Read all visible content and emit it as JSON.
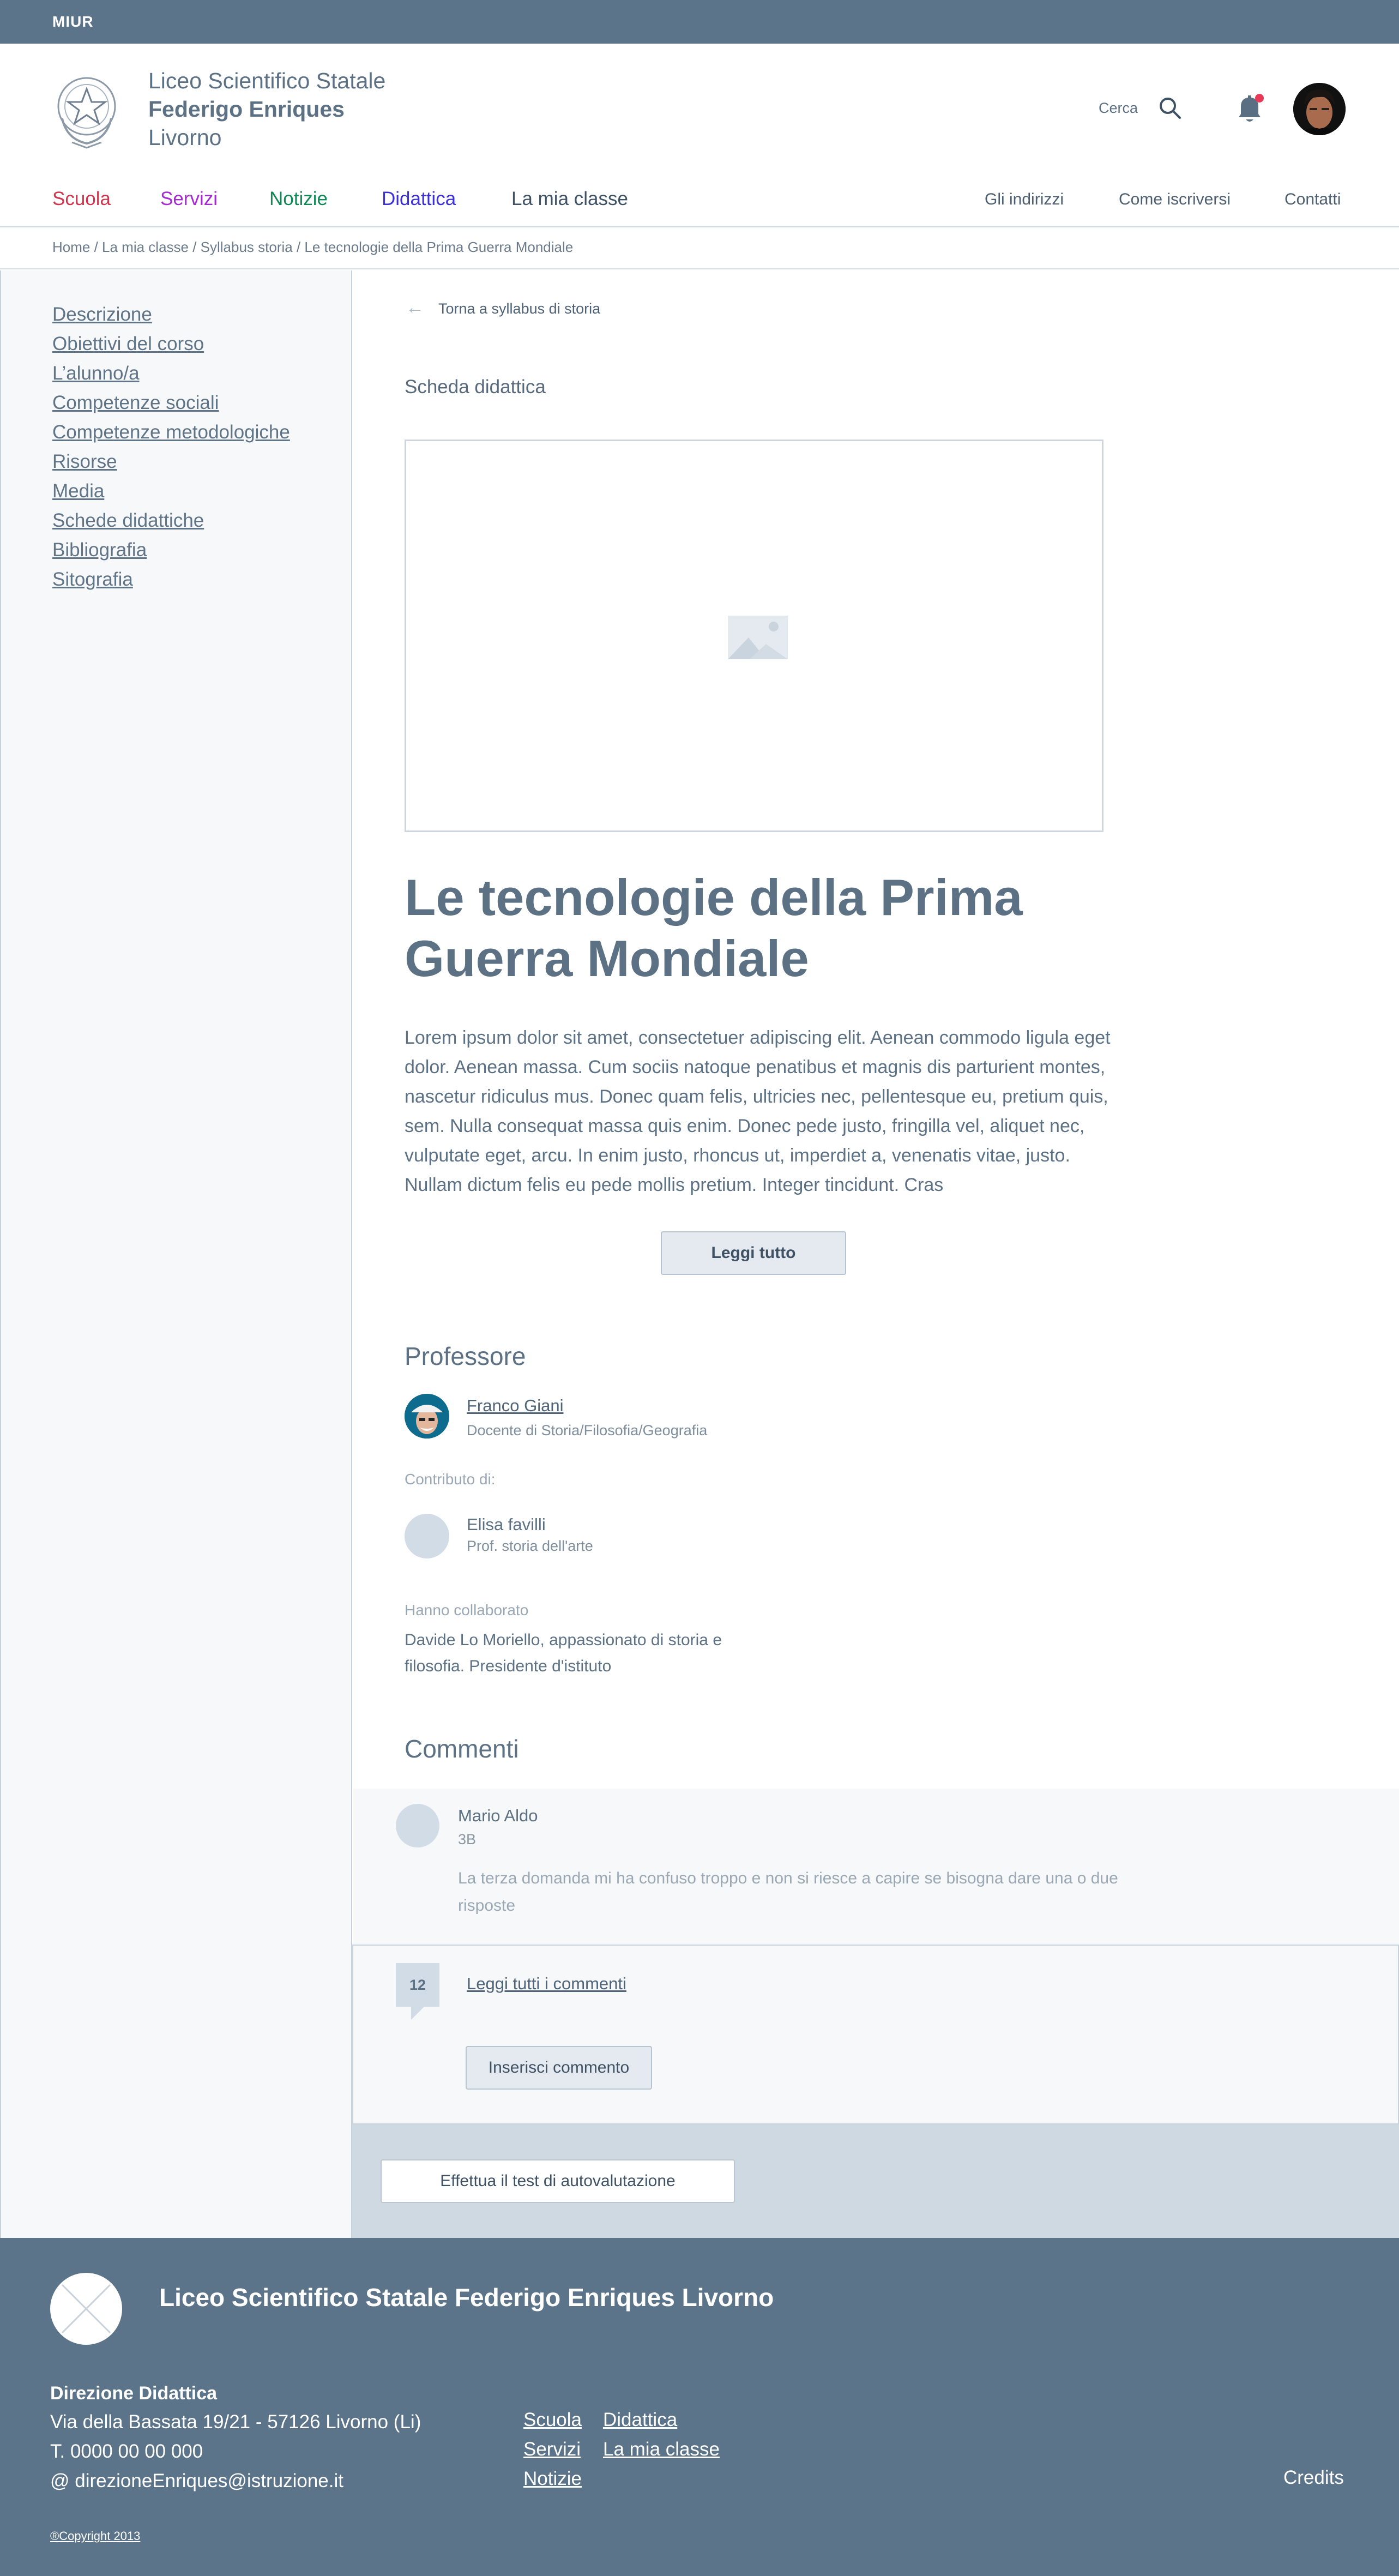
{
  "topbar": {
    "label": "MIUR"
  },
  "header": {
    "school_line1": "Liceo Scientifico Statale",
    "school_line2": "Federigo Enriques",
    "school_line3": "Livorno",
    "search_label": "Cerca",
    "notification_dot_color": "#e63a57"
  },
  "nav": {
    "items": [
      {
        "label": "Scuola",
        "color": "#d1344c"
      },
      {
        "label": "Servizi",
        "color": "#a62ad1"
      },
      {
        "label": "Notizie",
        "color": "#0d8a55"
      },
      {
        "label": "Didattica",
        "color": "#3b2fd6"
      },
      {
        "label": "La mia classe",
        "color": "#3f5265"
      }
    ],
    "secondary": [
      "Gli indirizzi",
      "Come iscriversi",
      "Contatti"
    ]
  },
  "breadcrumb": "Home / La mia classe / Syllabus storia / Le tecnologie della Prima Guerra Mondiale",
  "sidebar": {
    "items": [
      "Descrizione",
      "Obiettivi del corso",
      "L’alunno/a",
      "Competenze sociali",
      "Competenze metodologiche",
      "Risorse",
      "Media",
      "Schede didattiche",
      "Bibliografia",
      "Sitografia"
    ]
  },
  "content": {
    "back_link": "Torna a syllabus di storia",
    "section_label": "Scheda didattica",
    "title": "Le tecnologie della Prima Guerra Mondiale",
    "body": "Lorem ipsum dolor sit amet, consectetuer adipiscing elit. Aenean commodo ligula eget dolor. Aenean massa. Cum sociis natoque penatibus et magnis dis parturient montes, nascetur ridiculus mus. Donec quam felis, ultricies nec, pellentesque eu, pretium quis, sem. Nulla consequat massa quis enim. Donec pede justo, fringilla vel, aliquet nec, vulputate eget, arcu. In enim justo, rhoncus ut, imperdiet a, venenatis vitae, justo. Nullam dictum felis eu pede mollis pretium. Integer tincidunt. Cras",
    "read_more": "Leggi tutto"
  },
  "professor": {
    "heading": "Professore",
    "name": "Franco Giani",
    "role": "Docente di Storia/Filosofia/Geografia",
    "contrib_label": "Contributo di:",
    "contributor_name": "Elisa favilli",
    "contributor_role": "Prof. storia dell'arte",
    "collab_label": "Hanno collaborato",
    "collab_text": "Davide Lo Moriello, appassionato di storia e filosofia. Presidente d'istituto"
  },
  "comments": {
    "heading": "Commenti",
    "author": "Mario Aldo",
    "class": "3B",
    "text": "La terza domanda mi ha confuso troppo e non si riesce a capire se bisogna dare una o due risposte",
    "count": "12",
    "read_all": "Leggi tutti i commenti",
    "insert": "Inserisci commento"
  },
  "test_button": "Effettua il test di autovalutazione",
  "footer": {
    "title": "Liceo Scientifico Statale Federigo Enriques Livorno",
    "dir_heading": "Direzione Didattica",
    "address": "Via della Bassata 19/21 - 57126 Livorno (Li)",
    "phone": "T. 0000 00 00 000",
    "email": "@ direzioneEnriques@istruzione.it",
    "links_col1": [
      "Scuola",
      "Servizi",
      "Notizie"
    ],
    "links_col2": [
      "Didattica",
      "La mia classe"
    ],
    "credits": "Credits",
    "copyright": "®Copyright 2013"
  }
}
